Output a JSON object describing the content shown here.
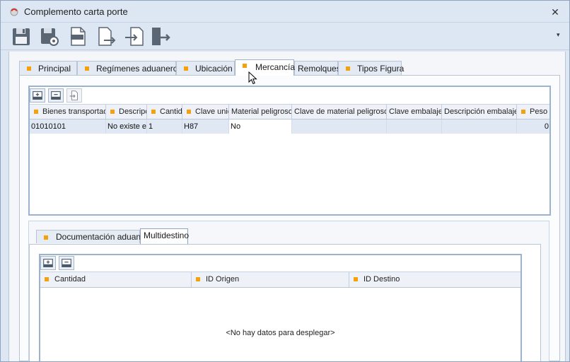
{
  "window": {
    "title": "Complemento carta porte",
    "close_label": "✕"
  },
  "toolbar": {
    "buttons": [
      {
        "name": "save-icon"
      },
      {
        "name": "save-settings-icon"
      },
      {
        "name": "pdf-icon"
      },
      {
        "name": "export-icon"
      },
      {
        "name": "import-icon"
      },
      {
        "name": "exit-icon"
      }
    ],
    "dropdown_label": "▾"
  },
  "tabs": [
    {
      "label": "Principal",
      "dot": true
    },
    {
      "label": "Regímenes aduaneros",
      "dot": true
    },
    {
      "label": "Ubicación",
      "dot": true
    },
    {
      "label": "Mercancía",
      "dot": true,
      "active": true
    },
    {
      "label": "Remolques",
      "dot": false
    },
    {
      "label": "Tipos Figura",
      "dot": true
    }
  ],
  "mercancia_grid": {
    "columns": [
      {
        "label": "Bienes transportados",
        "dot": true
      },
      {
        "label": "Descripción",
        "dot": true
      },
      {
        "label": "Cantidad",
        "dot": true
      },
      {
        "label": "Clave unidad",
        "dot": true
      },
      {
        "label": "Material peligroso",
        "dot": false
      },
      {
        "label": "Clave de material peligroso",
        "dot": false
      },
      {
        "label": "Clave embalaje",
        "dot": false
      },
      {
        "label": "Descripción embalaje",
        "dot": false
      },
      {
        "label": "Peso",
        "dot": true
      }
    ],
    "rows": [
      [
        "01010101",
        "No existe en el catálogo",
        "1",
        "H87",
        "No",
        "",
        "",
        "",
        "0"
      ]
    ]
  },
  "subtabs": [
    {
      "label": "Documentación aduanera",
      "dot": true
    },
    {
      "label": "Multidestino",
      "dot": false,
      "active": true
    }
  ],
  "multidestino_grid": {
    "columns": [
      {
        "label": "Cantidad",
        "dot": true
      },
      {
        "label": "ID Origen",
        "dot": true
      },
      {
        "label": "ID Destino",
        "dot": true
      }
    ],
    "empty_text": "<No hay datos para desplegar>"
  },
  "colors": {
    "accent_dot": "#f5a10b",
    "frame": "#dde7f3",
    "grid_border": "#9db2cc",
    "selected_row": "#dfe8f3"
  }
}
